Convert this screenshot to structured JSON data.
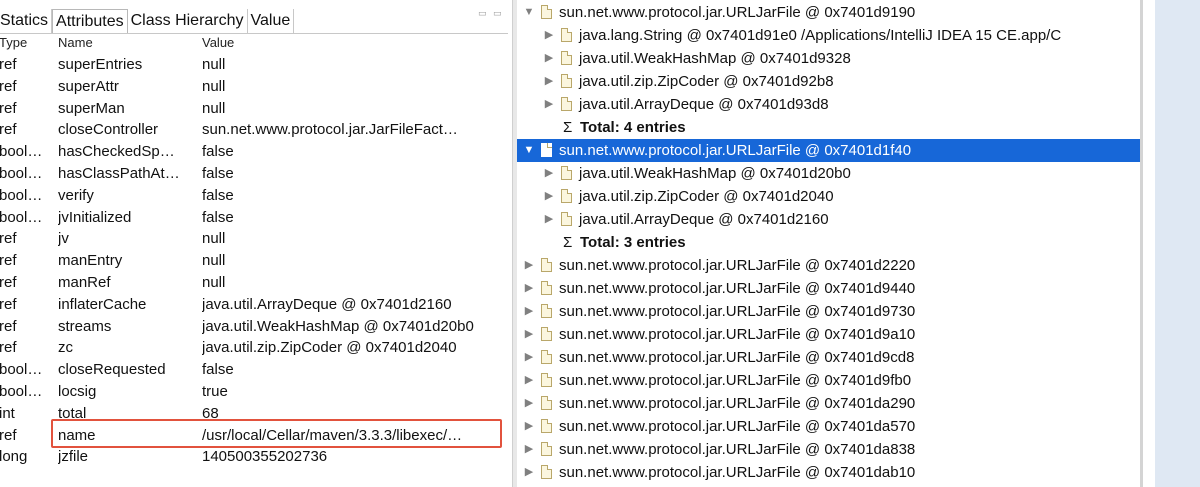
{
  "tabs": [
    "Statics",
    "Attributes",
    "Class Hierarchy",
    "Value"
  ],
  "active_tab": 1,
  "minmax_glyph": "▭ ▭",
  "table": {
    "headers": {
      "type": "Type",
      "name": "Name",
      "value": "Value"
    },
    "rows": [
      {
        "type": "ref",
        "name": "superEntries",
        "value": "null"
      },
      {
        "type": "ref",
        "name": "superAttr",
        "value": "null"
      },
      {
        "type": "ref",
        "name": "superMan",
        "value": "null"
      },
      {
        "type": "ref",
        "name": "closeController",
        "value": "sun.net.www.protocol.jar.JarFileFact…"
      },
      {
        "type": "bool…",
        "name": "hasCheckedSp…",
        "value": "false"
      },
      {
        "type": "bool…",
        "name": "hasClassPathAt…",
        "value": "false"
      },
      {
        "type": "bool…",
        "name": "verify",
        "value": "false"
      },
      {
        "type": "bool…",
        "name": "jvInitialized",
        "value": "false"
      },
      {
        "type": "ref",
        "name": "jv",
        "value": "null"
      },
      {
        "type": "ref",
        "name": "manEntry",
        "value": "null"
      },
      {
        "type": "ref",
        "name": "manRef",
        "value": "null"
      },
      {
        "type": "ref",
        "name": "inflaterCache",
        "value": "java.util.ArrayDeque @ 0x7401d2160"
      },
      {
        "type": "ref",
        "name": "streams",
        "value": "java.util.WeakHashMap @ 0x7401d20b0"
      },
      {
        "type": "ref",
        "name": "zc",
        "value": "java.util.zip.ZipCoder @ 0x7401d2040"
      },
      {
        "type": "bool…",
        "name": "closeRequested",
        "value": "false"
      },
      {
        "type": "bool…",
        "name": "locsig",
        "value": "true"
      },
      {
        "type": "int",
        "name": "total",
        "value": "68"
      },
      {
        "type": "ref",
        "name": "name",
        "value": "/usr/local/Cellar/maven/3.3.3/libexec/…"
      },
      {
        "type": "long",
        "name": "jzfile",
        "value": "140500355202736"
      }
    ],
    "highlighted_row": 17
  },
  "tree": {
    "selected_row": 6,
    "rows": [
      {
        "kind": "node",
        "level": 0,
        "expanded": true,
        "label": "sun.net.www.protocol.jar.URLJarFile @ 0x7401d9190"
      },
      {
        "kind": "node",
        "level": 1,
        "expanded": false,
        "label": "java.lang.String @ 0x7401d91e0  /Applications/IntelliJ IDEA 15 CE.app/C"
      },
      {
        "kind": "node",
        "level": 1,
        "expanded": false,
        "label": "java.util.WeakHashMap @ 0x7401d9328"
      },
      {
        "kind": "node",
        "level": 1,
        "expanded": false,
        "label": "java.util.zip.ZipCoder @ 0x7401d92b8"
      },
      {
        "kind": "node",
        "level": 1,
        "expanded": false,
        "label": "java.util.ArrayDeque @ 0x7401d93d8"
      },
      {
        "kind": "total",
        "level": 1,
        "symbol": "Σ",
        "label": "Total: 4 entries"
      },
      {
        "kind": "node",
        "level": 0,
        "expanded": true,
        "label": "sun.net.www.protocol.jar.URLJarFile @ 0x7401d1f40"
      },
      {
        "kind": "node",
        "level": 1,
        "expanded": false,
        "label": "java.util.WeakHashMap @ 0x7401d20b0"
      },
      {
        "kind": "node",
        "level": 1,
        "expanded": false,
        "label": "java.util.zip.ZipCoder @ 0x7401d2040"
      },
      {
        "kind": "node",
        "level": 1,
        "expanded": false,
        "label": "java.util.ArrayDeque @ 0x7401d2160"
      },
      {
        "kind": "total",
        "level": 1,
        "symbol": "Σ",
        "label": "Total: 3 entries"
      },
      {
        "kind": "node",
        "level": 0,
        "expanded": false,
        "label": "sun.net.www.protocol.jar.URLJarFile @ 0x7401d2220"
      },
      {
        "kind": "node",
        "level": 0,
        "expanded": false,
        "label": "sun.net.www.protocol.jar.URLJarFile @ 0x7401d9440"
      },
      {
        "kind": "node",
        "level": 0,
        "expanded": false,
        "label": "sun.net.www.protocol.jar.URLJarFile @ 0x7401d9730"
      },
      {
        "kind": "node",
        "level": 0,
        "expanded": false,
        "label": "sun.net.www.protocol.jar.URLJarFile @ 0x7401d9a10"
      },
      {
        "kind": "node",
        "level": 0,
        "expanded": false,
        "label": "sun.net.www.protocol.jar.URLJarFile @ 0x7401d9cd8"
      },
      {
        "kind": "node",
        "level": 0,
        "expanded": false,
        "label": "sun.net.www.protocol.jar.URLJarFile @ 0x7401d9fb0"
      },
      {
        "kind": "node",
        "level": 0,
        "expanded": false,
        "label": "sun.net.www.protocol.jar.URLJarFile @ 0x7401da290"
      },
      {
        "kind": "node",
        "level": 0,
        "expanded": false,
        "label": "sun.net.www.protocol.jar.URLJarFile @ 0x7401da570"
      },
      {
        "kind": "node",
        "level": 0,
        "expanded": false,
        "label": "sun.net.www.protocol.jar.URLJarFile @ 0x7401da838"
      },
      {
        "kind": "node",
        "level": 0,
        "expanded": false,
        "label": "sun.net.www.protocol.jar.URLJarFile @ 0x7401dab10"
      }
    ]
  },
  "colors": {
    "selection": "#1767d8",
    "highlight_border": "#e2523d",
    "sidebar": "#dfe8f3"
  }
}
